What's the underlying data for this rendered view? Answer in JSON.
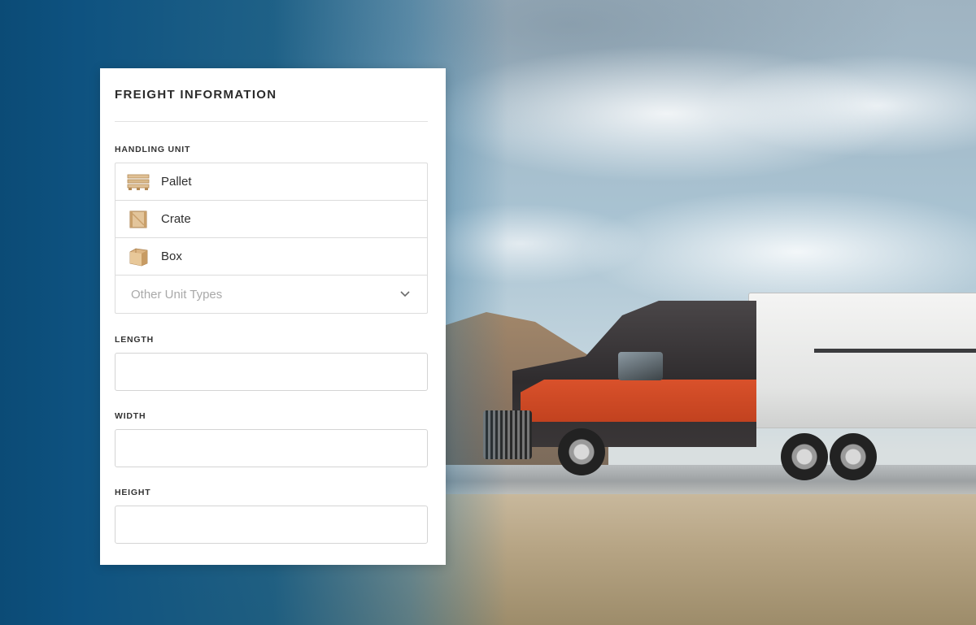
{
  "form": {
    "title": "FREIGHT INFORMATION",
    "handling_unit": {
      "label": "HANDLING UNIT",
      "options": [
        {
          "label": "Pallet",
          "icon": "pallet-icon"
        },
        {
          "label": "Crate",
          "icon": "crate-icon"
        },
        {
          "label": "Box",
          "icon": "box-icon"
        }
      ],
      "other_select": {
        "placeholder": "Other Unit Types",
        "icon": "chevron-down-icon"
      }
    },
    "length": {
      "label": "LENGTH",
      "value": ""
    },
    "width": {
      "label": "WIDTH",
      "value": ""
    },
    "height": {
      "label": "HEIGHT",
      "value": ""
    }
  },
  "colors": {
    "card_background": "#ffffff",
    "border": "#dcdcdc",
    "text": "#2e2e2e",
    "placeholder": "#a9a9a9",
    "background_blue": "#0d4d78",
    "wood": "#d9b98a"
  }
}
